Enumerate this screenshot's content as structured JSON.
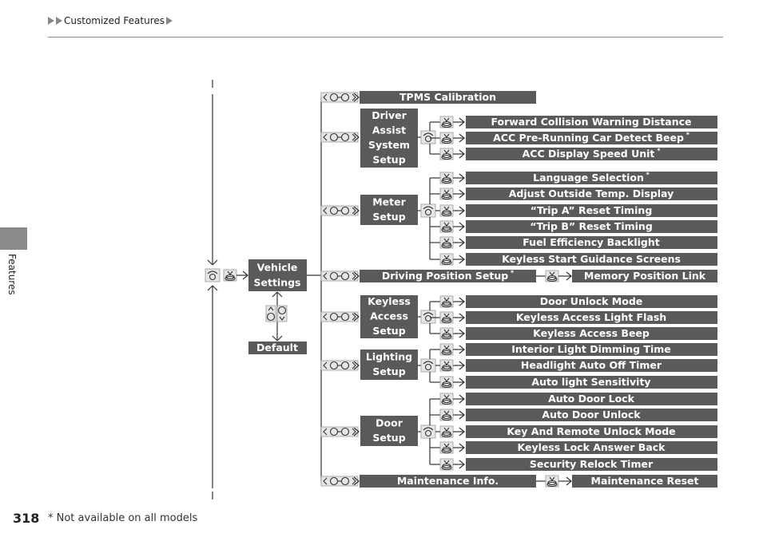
{
  "header": {
    "breadcrumb": "Customized Features"
  },
  "side_tab": {
    "label": "Features"
  },
  "footer": {
    "page_number": "318",
    "footnote": "* Not available on all models"
  },
  "diagram": {
    "root": {
      "label_lines": [
        "Vehicle",
        "Settings"
      ]
    },
    "default": {
      "label": "Default"
    },
    "colors": {
      "box": "#5a5a5a",
      "line": "#333333",
      "icon_bg": "#e6e6e6"
    },
    "groups": [
      {
        "id": "tpms",
        "label_lines": [
          "TPMS Calibration"
        ],
        "kind": "bar",
        "children": []
      },
      {
        "id": "driver-assist",
        "label_lines": [
          "Driver",
          "Assist",
          "System",
          "Setup"
        ],
        "kind": "box",
        "children": [
          {
            "label": "Forward Collision Warning Distance",
            "note": ""
          },
          {
            "label": "ACC Pre-Running Car Detect Beep",
            "note": "*"
          },
          {
            "label": "ACC Display Speed Unit",
            "note": "*"
          }
        ]
      },
      {
        "id": "meter",
        "label_lines": [
          "Meter",
          "Setup"
        ],
        "kind": "box",
        "children": [
          {
            "label": "Language Selection",
            "note": "*"
          },
          {
            "label": "Adjust Outside Temp. Display",
            "note": ""
          },
          {
            "label": "“Trip A” Reset Timing",
            "note": ""
          },
          {
            "label": "“Trip B” Reset Timing",
            "note": ""
          },
          {
            "label": "Fuel Efficiency Backlight",
            "note": ""
          },
          {
            "label": "Keyless Start Guidance Screens",
            "note": ""
          }
        ]
      },
      {
        "id": "driving-position",
        "label_lines": [
          "Driving Position Setup"
        ],
        "note": "*",
        "kind": "bar",
        "linked": {
          "label": "Memory Position Link"
        }
      },
      {
        "id": "keyless-access",
        "label_lines": [
          "Keyless",
          "Access",
          "Setup"
        ],
        "kind": "box",
        "children": [
          {
            "label": "Door Unlock Mode",
            "note": ""
          },
          {
            "label": "Keyless Access Light Flash",
            "note": ""
          },
          {
            "label": "Keyless Access Beep",
            "note": ""
          }
        ]
      },
      {
        "id": "lighting",
        "label_lines": [
          "Lighting",
          "Setup"
        ],
        "kind": "box",
        "children": [
          {
            "label": "Interior Light Dimming Time",
            "note": ""
          },
          {
            "label": "Headlight Auto Off Timer",
            "note": ""
          },
          {
            "label": "Auto light Sensitivity",
            "note": ""
          }
        ]
      },
      {
        "id": "door",
        "label_lines": [
          "Door",
          "Setup"
        ],
        "kind": "box",
        "children": [
          {
            "label": "Auto Door Lock",
            "note": ""
          },
          {
            "label": "Auto Door Unlock",
            "note": ""
          },
          {
            "label": "Key And Remote Unlock Mode",
            "note": ""
          },
          {
            "label": "Keyless Lock Answer Back",
            "note": ""
          },
          {
            "label": "Security Relock Timer",
            "note": ""
          }
        ]
      },
      {
        "id": "maintenance",
        "label_lines": [
          "Maintenance Info."
        ],
        "kind": "bar",
        "linked": {
          "label": "Maintenance Reset"
        }
      }
    ],
    "icons": {
      "scroll": "selector-wheel-left-right-icon",
      "press": "selector-wheel-press-icon",
      "phone": "phone-talk-icon",
      "updown": "selector-wheel-up-down-icon"
    }
  }
}
